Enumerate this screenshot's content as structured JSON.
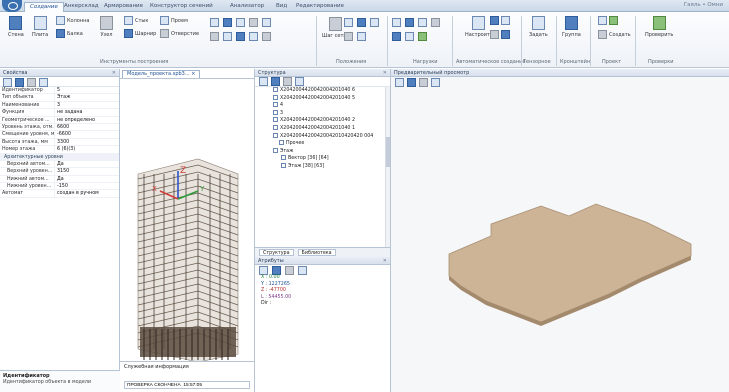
{
  "tabs": [
    "Создание",
    "Анкерсклад",
    "Армирование",
    "Конструктор сечений",
    "Анализатор",
    "Вид",
    "Редактирование"
  ],
  "tab_right": "Гаяль • Омни",
  "ribbon": {
    "small_labels": [
      "Стена",
      "Плита",
      "Колонна",
      "Балка",
      "Узел",
      "Стык",
      "Шарнир",
      "Проем",
      "Отверстие"
    ],
    "group_labels": {
      "build": "Инструменты построения",
      "positions": "Положения",
      "loads": "Нагрузки",
      "auto": "Автоматическое создание",
      "templ": "Тензорное",
      "bracket": "Кронштейн",
      "project": "Проект",
      "check": "Проверки"
    },
    "mid_label": "Шаг сетки",
    "right_label_1": "Настроить",
    "right_label_2": "Задать",
    "right_label_3": "Группа",
    "right_label_4": "Создать",
    "right_label_5": "Проверить"
  },
  "props": {
    "title": "Свойства",
    "rows": [
      {
        "k": "Идентификатор",
        "v": "5",
        "type": "row"
      },
      {
        "k": "Тип объекта",
        "v": "Этаж",
        "type": "row"
      },
      {
        "k": "Наименование",
        "v": "3",
        "type": "row"
      },
      {
        "k": "Функция",
        "v": "не задана",
        "type": "row"
      },
      {
        "k": "Геометрическое ...",
        "v": "не определено",
        "type": "row"
      },
      {
        "k": "Уровень этажа, отм.",
        "v": "6600",
        "type": "row"
      },
      {
        "k": "Смещение уровня, мм",
        "v": "-6600",
        "type": "row"
      },
      {
        "k": "Высота этажа, мм",
        "v": "3300",
        "type": "row"
      },
      {
        "k": "Номер этажа",
        "v": "6 (6)(3)",
        "type": "row"
      },
      {
        "k": "Архитектурные уровни",
        "v": "",
        "type": "grp"
      },
      {
        "k": "Верхний автом...",
        "v": "Да",
        "type": "sub"
      },
      {
        "k": "Верхний уровен...",
        "v": "3150",
        "type": "sub"
      },
      {
        "k": "Нижний автом...",
        "v": "Да",
        "type": "sub"
      },
      {
        "k": "Нижний уровен...",
        "v": "-150",
        "type": "sub"
      },
      {
        "k": "Автомат",
        "v": "создан в ручном",
        "type": "row"
      }
    ],
    "desc_title": "Идентификатор",
    "desc_text": "Идентификатор объекта в модели"
  },
  "view3d": {
    "tab": "Модель_проекта.spb3... ×",
    "axes": {
      "x": "X",
      "y": "Y",
      "z": "Z"
    }
  },
  "service": {
    "title": "Служебная информация",
    "value": "ПРОВЕРКА СКОНЧЕНА  15:57:05"
  },
  "structure": {
    "title": "Структура",
    "items": [
      {
        "label": "X2042004420042004201040 6",
        "indent": 18
      },
      {
        "label": "X2042004420042004201040 5",
        "indent": 18
      },
      {
        "label": "4",
        "indent": 18
      },
      {
        "label": "3",
        "indent": 18
      },
      {
        "label": "X2042004420042004201040 2",
        "indent": 18
      },
      {
        "label": "X2042004420042004201040 1",
        "indent": 18
      },
      {
        "label": "X20420044200420042010420420 004",
        "indent": 18
      },
      {
        "label": "Прочее",
        "indent": 24
      },
      {
        "label": "Этаж",
        "indent": 18
      },
      {
        "label": "Вектор [36] [64]",
        "indent": 26
      },
      {
        "label": "Этаж [38] [63]",
        "indent": 26
      }
    ],
    "tab1": "Структура",
    "tab2": "Библиотека"
  },
  "snaps": {
    "title": "Атрибуты",
    "coords": {
      "x": "X : 0.00",
      "y": "Y : 1227265",
      "z": "Z : -47700",
      "l": "L : 54455.00",
      "extra": "Dir :"
    }
  },
  "preview": {
    "title": "Предварительный просмотр"
  },
  "colors": {
    "accent": "#1d4f91",
    "slab": "#cdb497",
    "building": "#6b5e52",
    "axis_x": "#d23b3b",
    "axis_y": "#2f9a3c",
    "axis_z": "#2b54c9"
  }
}
